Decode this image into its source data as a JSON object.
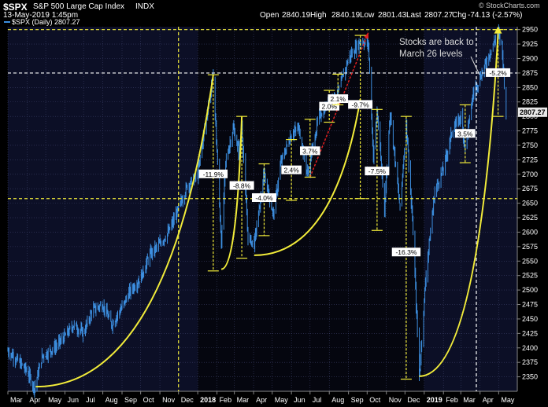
{
  "header": {
    "symbol": "$SPX",
    "name": "S&P 500 Large Cap Index",
    "exchange": "INDX",
    "date": "13-May-2019 1:45pm",
    "series_label": "$SPX (Daily) 2807.27",
    "open_label": "Open",
    "open": "2840.19",
    "high_label": "High",
    "high": "2840.19",
    "low_label": "Low",
    "low": "2801.43",
    "last_label": "Last",
    "last": "2807.27",
    "chg_label": "Chg",
    "chg": "-74.13 (-2.57%)",
    "watermark": "© StockCharts.com"
  },
  "colors": {
    "background": "#000000",
    "plot": "#0c0f26",
    "plot_dark": "#05060f",
    "grid": "#3a3f66",
    "bars": "#3d8fe0",
    "yellow": "#f2ec3a",
    "red": "#e02020",
    "white": "#ffffff",
    "last_bg": "#e8e8e8"
  },
  "chart_data": {
    "type": "line",
    "series": [
      {
        "x": [
          "2017-03-01",
          "2017-03-15",
          "2017-04-01",
          "2017-04-13",
          "2017-04-25",
          "2017-05-15",
          "2017-06-01",
          "2017-06-15",
          "2017-07-01",
          "2017-07-15",
          "2017-08-01",
          "2017-08-15",
          "2017-09-01",
          "2017-09-15",
          "2017-10-01",
          "2017-10-15",
          "2017-11-01",
          "2017-11-15",
          "2017-12-01",
          "2017-12-15",
          "2018-01-01",
          "2018-01-15",
          "2018-01-26",
          "2018-02-08",
          "2018-02-15",
          "2018-02-27",
          "2018-03-08",
          "2018-03-13",
          "2018-03-23",
          "2018-04-02",
          "2018-04-18",
          "2018-05-03",
          "2018-05-15",
          "2018-06-01",
          "2018-06-13",
          "2018-06-27",
          "2018-07-15",
          "2018-08-01",
          "2018-08-15",
          "2018-09-01",
          "2018-09-20",
          "2018-10-03",
          "2018-10-11",
          "2018-10-17",
          "2018-10-29",
          "2018-11-07",
          "2018-11-23",
          "2018-12-03",
          "2018-12-14",
          "2018-12-24",
          "2019-01-04",
          "2019-01-18",
          "2019-02-01",
          "2019-02-15",
          "2019-03-01",
          "2019-03-08",
          "2019-03-21",
          "2019-04-01",
          "2019-04-15",
          "2019-04-30",
          "2019-05-06",
          "2019-05-13"
        ],
        "y": [
          2395,
          2380,
          2360,
          2330,
          2385,
          2400,
          2420,
          2440,
          2425,
          2465,
          2475,
          2440,
          2470,
          2500,
          2520,
          2560,
          2580,
          2600,
          2640,
          2680,
          2700,
          2800,
          2872,
          2581,
          2720,
          2780,
          2740,
          2785,
          2590,
          2580,
          2700,
          2630,
          2720,
          2770,
          2780,
          2700,
          2800,
          2825,
          2840,
          2900,
          2930,
          2925,
          2730,
          2810,
          2640,
          2810,
          2640,
          2790,
          2600,
          2351,
          2530,
          2670,
          2710,
          2775,
          2800,
          2745,
          2840,
          2867,
          2905,
          2945,
          2925,
          2807
        ]
      }
    ],
    "xlim": [
      "2017-03-01",
      "2019-05-31"
    ],
    "ylim": [
      2325,
      2955
    ],
    "y_ticks": [
      2350,
      2375,
      2400,
      2425,
      2450,
      2475,
      2500,
      2525,
      2550,
      2575,
      2600,
      2625,
      2650,
      2675,
      2700,
      2725,
      2750,
      2775,
      2800,
      2825,
      2850,
      2875,
      2900,
      2925,
      2950
    ],
    "x_ticks": [
      {
        "label": "Mar",
        "date": "2017-03-01"
      },
      {
        "label": "Apr",
        "date": "2017-04-01"
      },
      {
        "label": "May",
        "date": "2017-05-01"
      },
      {
        "label": "Jun",
        "date": "2017-06-01"
      },
      {
        "label": "Jul",
        "date": "2017-07-01"
      },
      {
        "label": "Aug",
        "date": "2017-08-01"
      },
      {
        "label": "Sep",
        "date": "2017-09-01"
      },
      {
        "label": "Oct",
        "date": "2017-10-01"
      },
      {
        "label": "Nov",
        "date": "2017-11-01"
      },
      {
        "label": "Dec",
        "date": "2017-12-01"
      },
      {
        "label": "2018",
        "date": "2018-01-01",
        "bold": true
      },
      {
        "label": "Feb",
        "date": "2018-02-01"
      },
      {
        "label": "Mar",
        "date": "2018-03-01"
      },
      {
        "label": "Apr",
        "date": "2018-04-01"
      },
      {
        "label": "May",
        "date": "2018-05-01"
      },
      {
        "label": "Jun",
        "date": "2018-06-01"
      },
      {
        "label": "Jul",
        "date": "2018-07-01"
      },
      {
        "label": "Aug",
        "date": "2018-08-01"
      },
      {
        "label": "Sep",
        "date": "2018-09-01"
      },
      {
        "label": "Oct",
        "date": "2018-10-01"
      },
      {
        "label": "Nov",
        "date": "2018-11-01"
      },
      {
        "label": "Dec",
        "date": "2018-12-01"
      },
      {
        "label": "2019",
        "date": "2019-01-01",
        "bold": true
      },
      {
        "label": "Feb",
        "date": "2019-02-01"
      },
      {
        "label": "Mar",
        "date": "2019-03-01"
      },
      {
        "label": "Apr",
        "date": "2019-04-01"
      },
      {
        "label": "May",
        "date": "2019-05-01"
      }
    ],
    "last_value_label": "2807.27",
    "hlines": [
      {
        "y": 2950,
        "style": "yellow-dashed"
      },
      {
        "y": 2658,
        "style": "yellow-dashed"
      },
      {
        "y": 2875,
        "style": "white-dashed"
      }
    ],
    "vlines": [
      {
        "x": "2017-12-01",
        "style": "yellow-dashed"
      },
      {
        "x": "2019-03-26",
        "style": "white-dashed"
      }
    ],
    "drawdowns": [
      {
        "label": "-11.9%",
        "x": "2018-01-26",
        "y_top": 2872,
        "y_bottom": 2533,
        "x_end": "2018-02-08",
        "label_y": 2700
      },
      {
        "label": "-8.8%",
        "x": "2018-03-13",
        "y_top": 2800,
        "y_bottom": 2555,
        "x_end": "2018-04-02",
        "label_y": 2680
      },
      {
        "label": "-4.0%",
        "x": "2018-04-18",
        "y_top": 2718,
        "y_bottom": 2594,
        "x_end": "2018-05-03",
        "label_y": 2659
      },
      {
        "label": "-9.7%",
        "x": "2018-09-20",
        "y_top": 2940,
        "y_bottom": 2658,
        "x_end": "2018-10-11",
        "label_y": 2820
      },
      {
        "label": "-7.5%",
        "x": "2018-10-17",
        "y_top": 2812,
        "y_bottom": 2603,
        "x_end": "2018-10-29",
        "label_y": 2705
      },
      {
        "label": "-16.3%",
        "x": "2018-12-03",
        "y_top": 2800,
        "y_bottom": 2346,
        "x_end": "2018-12-24",
        "label_y": 2565
      },
      {
        "label": "-5.2%",
        "x": "2019-04-30",
        "y_top": 2950,
        "y_bottom": 2800,
        "x_end": "2019-05-13",
        "label_y": 2875
      }
    ],
    "gains": [
      {
        "label": "2.4%",
        "x": "2018-06-01",
        "y_bottom": 2655,
        "y_top": 2760,
        "label_y": 2707
      },
      {
        "label": "3.7%",
        "x": "2018-07-01",
        "y_bottom": 2695,
        "y_top": 2795,
        "label_y": 2740
      },
      {
        "label": "2.0%",
        "x": "2018-08-01",
        "y_bottom": 2790,
        "y_top": 2845,
        "label_y": 2817
      },
      {
        "label": "2.1%",
        "x": "2018-08-15",
        "y_bottom": 2820,
        "y_top": 2873,
        "label_y": 2830
      },
      {
        "label": "3.5%",
        "x": "2019-03-08",
        "y_bottom": 2720,
        "y_top": 2820,
        "label_y": 2770
      }
    ],
    "arcs": [
      {
        "from": [
          "2017-04-15",
          2333
        ],
        "to": [
          "2018-01-26",
          2872
        ]
      },
      {
        "from": [
          "2018-02-08",
          2536
        ],
        "to": [
          "2018-03-13",
          2800
        ]
      },
      {
        "from": [
          "2018-04-02",
          2560
        ],
        "to": [
          "2018-09-20",
          2830
        ]
      },
      {
        "from": [
          "2018-12-24",
          2351
        ],
        "to": [
          "2019-04-30",
          2942
        ]
      }
    ],
    "red_arrow": {
      "from": [
        "2018-07-01",
        2695
      ],
      "to": [
        "2018-10-03",
        2945
      ]
    },
    "annotation": "Stocks are back to March 26 levels"
  }
}
